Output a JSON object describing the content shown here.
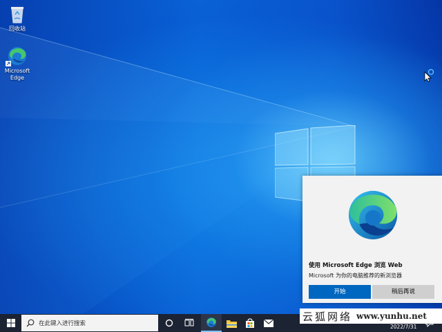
{
  "desktop": {
    "icons": [
      {
        "name": "recycle-bin",
        "label": "回收站"
      },
      {
        "name": "microsoft-edge",
        "label": "Microsoft Edge"
      }
    ]
  },
  "notification": {
    "title": "使用 Microsoft Edge 浏览 Web",
    "body": "Microsoft 为你的电脑推荐的新浏览器",
    "primary_button": "开始",
    "secondary_button": "稍后再说"
  },
  "taskbar": {
    "search_placeholder": "在此键入进行搜索",
    "pinned": [
      "cortana-icon",
      "task-view-icon",
      "edge-icon",
      "file-explorer-icon",
      "store-icon",
      "mail-icon"
    ],
    "date": "2022/7/31"
  },
  "watermark": {
    "name": "云狐网络",
    "url": "www.yunhu.net"
  }
}
